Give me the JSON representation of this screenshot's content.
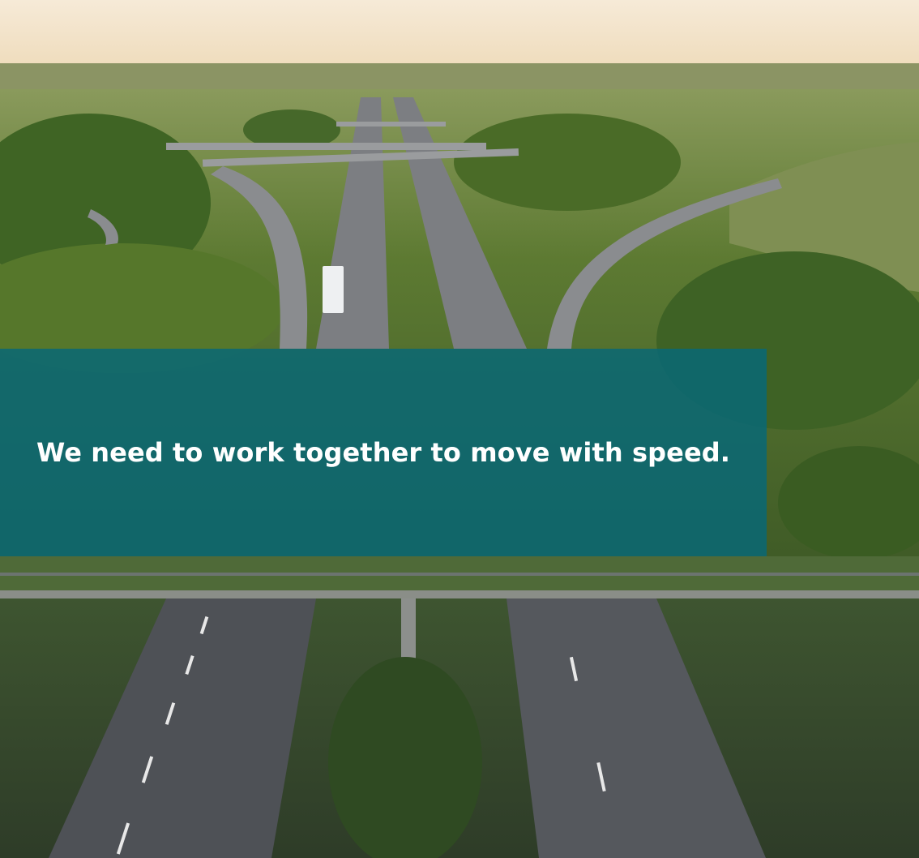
{
  "slide": {
    "headline": "We need to work together to move with speed."
  },
  "photo": {
    "subject": "aerial-highway-interchange",
    "colors": {
      "sky": "#f3e5cc",
      "foliage": "#4c6b2c",
      "road": "#5e6166",
      "banner": "#096874"
    }
  }
}
